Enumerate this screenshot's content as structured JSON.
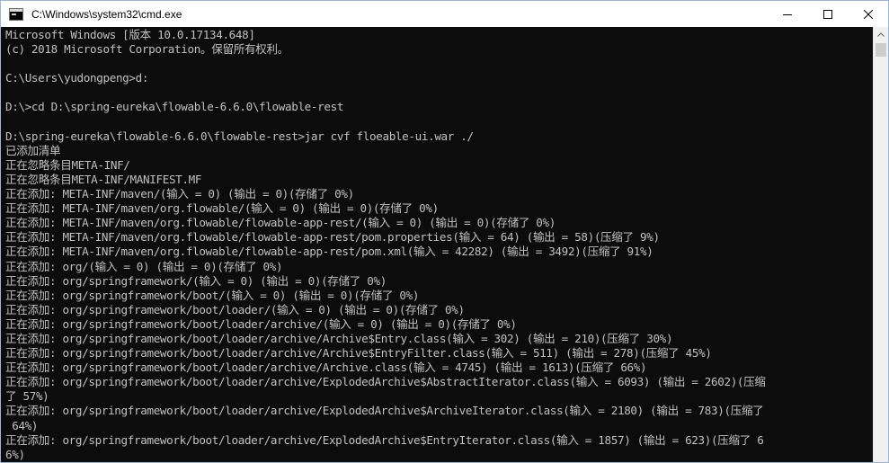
{
  "window": {
    "title": "C:\\Windows\\system32\\cmd.exe",
    "controls": {
      "minimize": "—",
      "maximize": "☐",
      "close": "✕"
    }
  },
  "console": {
    "lines": [
      "Microsoft Windows [版本 10.0.17134.648]",
      "(c) 2018 Microsoft Corporation。保留所有权利。",
      "",
      "C:\\Users\\yudongpeng>d:",
      "",
      "D:\\>cd D:\\spring-eureka\\flowable-6.6.0\\flowable-rest",
      "",
      "D:\\spring-eureka\\flowable-6.6.0\\flowable-rest>jar cvf floeable-ui.war ./",
      "已添加清单",
      "正在忽略条目META-INF/",
      "正在忽略条目META-INF/MANIFEST.MF",
      "正在添加: META-INF/maven/(输入 = 0) (输出 = 0)(存储了 0%)",
      "正在添加: META-INF/maven/org.flowable/(输入 = 0) (输出 = 0)(存储了 0%)",
      "正在添加: META-INF/maven/org.flowable/flowable-app-rest/(输入 = 0) (输出 = 0)(存储了 0%)",
      "正在添加: META-INF/maven/org.flowable/flowable-app-rest/pom.properties(输入 = 64) (输出 = 58)(压缩了 9%)",
      "正在添加: META-INF/maven/org.flowable/flowable-app-rest/pom.xml(输入 = 42282) (输出 = 3492)(压缩了 91%)",
      "正在添加: org/(输入 = 0) (输出 = 0)(存储了 0%)",
      "正在添加: org/springframework/(输入 = 0) (输出 = 0)(存储了 0%)",
      "正在添加: org/springframework/boot/(输入 = 0) (输出 = 0)(存储了 0%)",
      "正在添加: org/springframework/boot/loader/(输入 = 0) (输出 = 0)(存储了 0%)",
      "正在添加: org/springframework/boot/loader/archive/(输入 = 0) (输出 = 0)(存储了 0%)",
      "正在添加: org/springframework/boot/loader/archive/Archive$Entry.class(输入 = 302) (输出 = 210)(压缩了 30%)",
      "正在添加: org/springframework/boot/loader/archive/Archive$EntryFilter.class(输入 = 511) (输出 = 278)(压缩了 45%)",
      "正在添加: org/springframework/boot/loader/archive/Archive.class(输入 = 4745) (输出 = 1613)(压缩了 66%)",
      "正在添加: org/springframework/boot/loader/archive/ExplodedArchive$AbstractIterator.class(输入 = 6093) (输出 = 2602)(压缩",
      "了 57%)",
      "正在添加: org/springframework/boot/loader/archive/ExplodedArchive$ArchiveIterator.class(输入 = 2180) (输出 = 783)(压缩了",
      " 64%)",
      "正在添加: org/springframework/boot/loader/archive/ExplodedArchive$EntryIterator.class(输入 = 1857) (输出 = 623)(压缩了 6",
      "6%)"
    ]
  }
}
